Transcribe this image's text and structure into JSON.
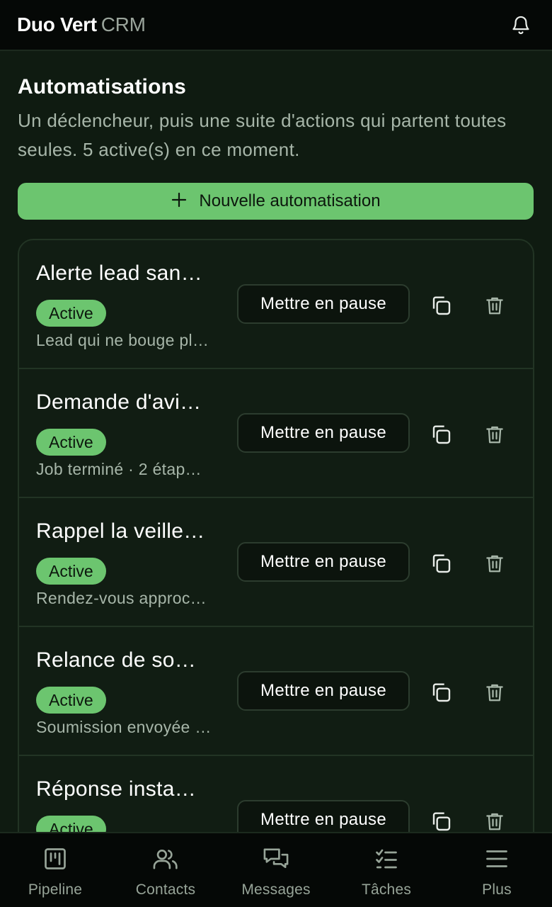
{
  "header": {
    "brand_primary": "Duo Vert",
    "brand_secondary": "CRM",
    "notifications_icon": "bell-icon"
  },
  "page": {
    "title": "Automatisations",
    "subtitle": "Un déclencheur, puis une suite d'actions qui partent toutes seules. 5 active(s) en ce moment.",
    "new_button_label": "Nouvelle automatisation"
  },
  "automations": [
    {
      "name": "Alerte lead san…",
      "status": "Active",
      "description": "Lead qui ne bouge pl…",
      "pause_label": "Mettre en pause"
    },
    {
      "name": "Demande d'avi…",
      "status": "Active",
      "description": "Job terminé · 2 étap…",
      "pause_label": "Mettre en pause"
    },
    {
      "name": "Rappel la veille…",
      "status": "Active",
      "description": "Rendez-vous approc…",
      "pause_label": "Mettre en pause"
    },
    {
      "name": "Relance de so…",
      "status": "Active",
      "description": "Soumission envoyée …",
      "pause_label": "Mettre en pause"
    },
    {
      "name": "Réponse insta…",
      "status": "Active",
      "description": "",
      "pause_label": "Mettre en pause"
    }
  ],
  "nav": [
    {
      "label": "Pipeline",
      "icon": "pipeline-icon"
    },
    {
      "label": "Contacts",
      "icon": "contacts-icon"
    },
    {
      "label": "Messages",
      "icon": "messages-icon"
    },
    {
      "label": "Tâches",
      "icon": "tasks-icon"
    },
    {
      "label": "Plus",
      "icon": "menu-icon"
    }
  ],
  "colors": {
    "accent": "#6cc56f",
    "background": "#0f1b11",
    "header": "#050806",
    "muted_text": "#a7b6a9"
  }
}
